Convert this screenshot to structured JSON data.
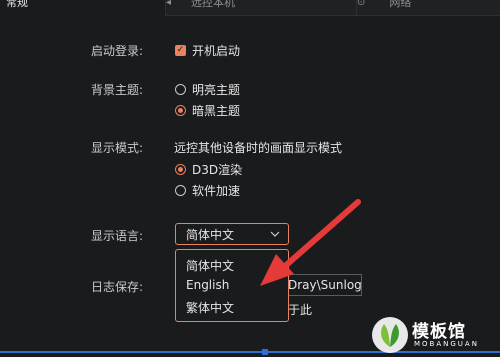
{
  "tabs": [
    {
      "label": "常规",
      "icon": "settings-icon"
    },
    {
      "label": "远控本机",
      "icon": "back-arrow-icon"
    },
    {
      "label": "网络",
      "icon": "network-icon"
    }
  ],
  "startup": {
    "label": "启动登录:",
    "checkbox_label": "开机启动",
    "checked": true
  },
  "theme": {
    "label": "背景主题:",
    "options": [
      {
        "label": "明亮主题",
        "selected": false
      },
      {
        "label": "暗黑主题",
        "selected": true
      }
    ]
  },
  "display_mode": {
    "label": "显示模式:",
    "description": "远控其他设备时的画面显示模式",
    "options": [
      {
        "label": "D3D渲染",
        "selected": true
      },
      {
        "label": "软件加速",
        "selected": false
      }
    ]
  },
  "language": {
    "label": "显示语言:",
    "selected": "简体中文",
    "options": [
      "简体中文",
      "English",
      "繁体中文"
    ]
  },
  "log": {
    "label": "日志保存:",
    "path_visible": "Dray\\Sunlog",
    "suffix_visible": "于此"
  },
  "watermark": {
    "text": "模板馆",
    "sub": "MOBANGUAN"
  },
  "colors": {
    "accent": "#e9825f",
    "background": "#1a1b1d",
    "arrow": "#e53a3a",
    "selection_line": "#2d6fd2"
  }
}
